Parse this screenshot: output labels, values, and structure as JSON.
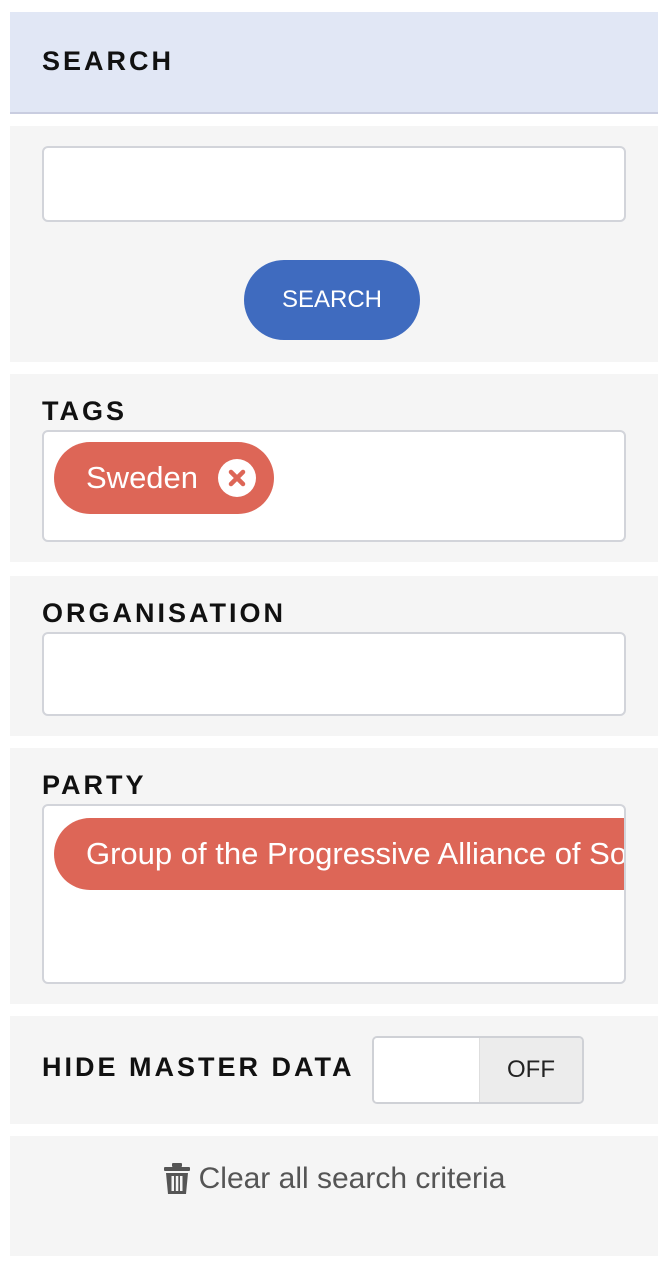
{
  "header": {
    "title": "SEARCH"
  },
  "search": {
    "value": "",
    "placeholder": "",
    "button_label": "SEARCH"
  },
  "tags": {
    "title": "TAGS",
    "chips": [
      {
        "label": "Sweden"
      }
    ]
  },
  "organisation": {
    "title": "ORGANISATION"
  },
  "party": {
    "title": "PARTY",
    "chips": [
      {
        "label": "Group of the Progressive Alliance of Socialists and Democrats in the European Parliament"
      }
    ]
  },
  "master_data": {
    "title": "HIDE MASTER DATA",
    "toggle_state": "OFF"
  },
  "clear": {
    "label": "Clear all search criteria",
    "icon": "trash-icon"
  },
  "colors": {
    "header_bg": "#e1e7f5",
    "primary": "#3f6bbf",
    "chip": "#dd6657",
    "panel_bg": "#f5f5f5"
  }
}
